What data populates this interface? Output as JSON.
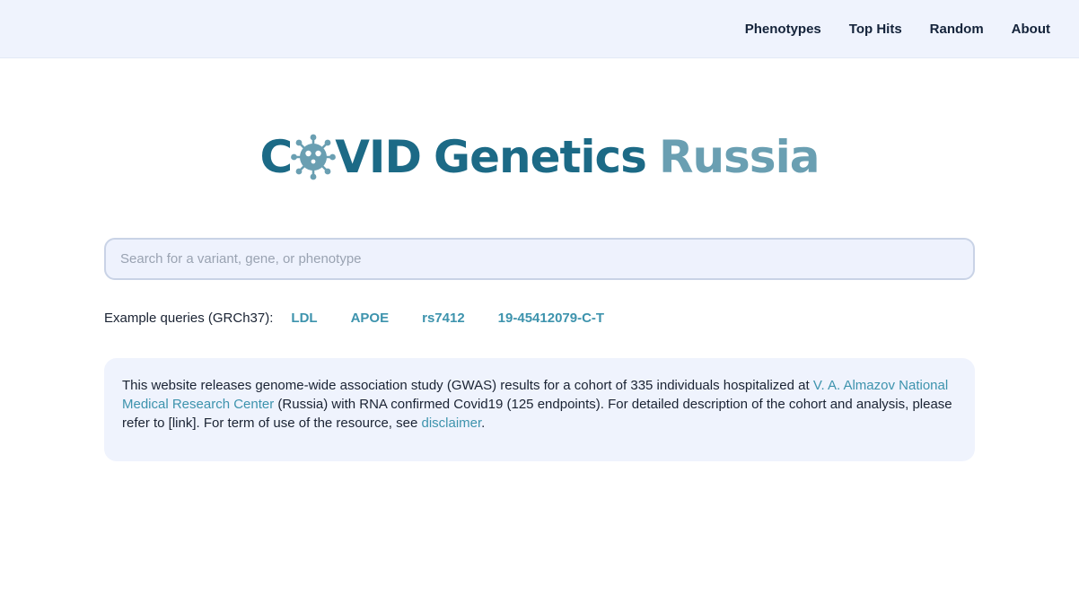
{
  "nav": {
    "items": [
      {
        "label": "Phenotypes"
      },
      {
        "label": "Top Hits"
      },
      {
        "label": "Random"
      },
      {
        "label": "About"
      }
    ]
  },
  "logo": {
    "part1": "C",
    "part2": "VID",
    "part3": "Genetics",
    "part4": "Russia",
    "icon": "coronavirus-icon",
    "colors": {
      "primary": "#1c6a86",
      "secondary": "#6a9fb2"
    }
  },
  "search": {
    "placeholder": "Search for a variant, gene, or phenotype",
    "value": ""
  },
  "examples": {
    "label": "Example queries (GRCh37):",
    "queries": [
      "LDL",
      "APOE",
      "rs7412",
      "19-45412079-C-T"
    ]
  },
  "info": {
    "text_1": "This website releases genome-wide association study (GWAS) results for a cohort of 335 individuals hospitalized at ",
    "link_center": "V. A. Almazov National Medical Research Center",
    "text_2": " (Russia) with RNA confirmed Covid19 (125 endpoints). For detailed description of the cohort and analysis, please refer to [link]. For term of use of the resource, see ",
    "link_disclaimer": "disclaimer",
    "text_3": "."
  },
  "colors": {
    "nav_bg": "#eff3fd",
    "link": "#3d93ad",
    "text": "#1a2333"
  }
}
